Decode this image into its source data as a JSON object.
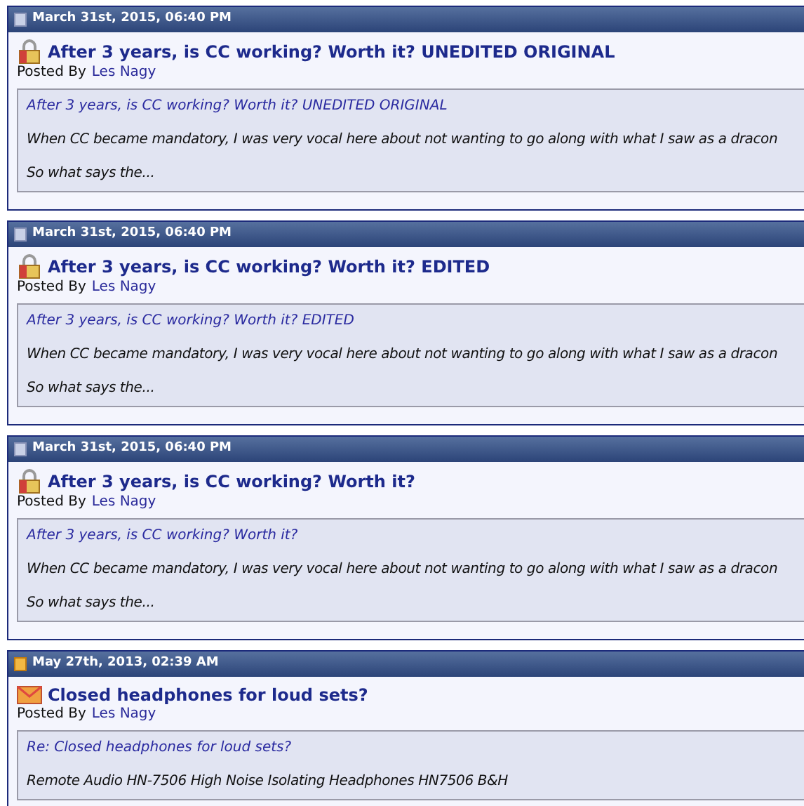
{
  "posts": [
    {
      "date": "March 31st, 2015, 06:40 PM",
      "unread": false,
      "kind": "lock",
      "title": "After 3 years, is CC working? Worth it? UNEDITED ORIGINAL",
      "posted_by_label": "Posted By",
      "author": "Les Nagy",
      "quote_title": "After 3 years, is CC working? Worth it? UNEDITED ORIGINAL",
      "lines": [
        "When CC became mandatory, I was very vocal here about not wanting to go along with what I saw as a dracon",
        "So what says the..."
      ]
    },
    {
      "date": "March 31st, 2015, 06:40 PM",
      "unread": false,
      "kind": "lock",
      "title": "After 3 years, is CC working? Worth it? EDITED",
      "posted_by_label": "Posted By",
      "author": "Les Nagy",
      "quote_title": "After 3 years, is CC working? Worth it? EDITED",
      "lines": [
        "When CC became mandatory, I was very vocal here about not wanting to go along with what I saw as a dracon",
        "So what says the..."
      ]
    },
    {
      "date": "March 31st, 2015, 06:40 PM",
      "unread": false,
      "kind": "lock",
      "title": "After 3 years, is CC working? Worth it?",
      "posted_by_label": "Posted By",
      "author": "Les Nagy",
      "quote_title": "After 3 years, is CC working? Worth it?",
      "lines": [
        "When CC became mandatory, I was very vocal here about not wanting to go along with what I saw as a dracon",
        "So what says the..."
      ]
    },
    {
      "date": "May 27th, 2013, 02:39 AM",
      "unread": true,
      "kind": "mail",
      "title": "Closed headphones for loud sets?",
      "posted_by_label": "Posted By",
      "author": "Les Nagy",
      "quote_title": "Re: Closed headphones for loud sets?",
      "lines": [
        "Remote Audio HN-7506 High Noise Isolating Headphones HN7506 B&H"
      ]
    }
  ]
}
